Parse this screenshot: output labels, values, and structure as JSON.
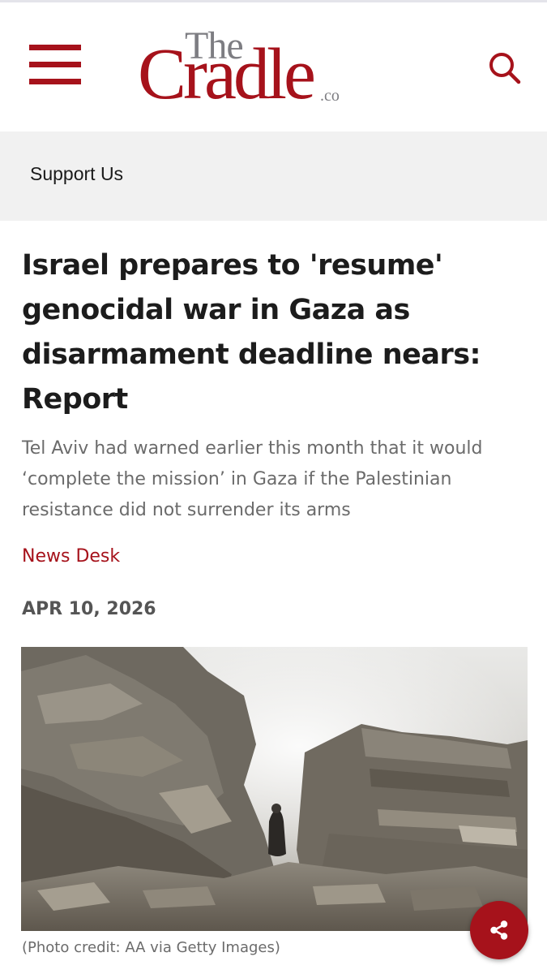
{
  "header": {
    "menu_icon": "hamburger-menu-icon",
    "logo": {
      "the": "The",
      "cradle": "Cradle",
      "co": ".co"
    },
    "search_icon": "search-icon",
    "brand_color": "#a6121b"
  },
  "support": {
    "label": "Support Us"
  },
  "article": {
    "headline": "Israel prepares to 'resume' genocidal war in Gaza as disarmament deadline nears: Report",
    "subtitle": "Tel Aviv had warned earlier this month that it would ‘complete the mission’ in Gaza if the Palestinian resistance did not surrender its arms",
    "author": "News Desk",
    "date": "APR 10, 2026",
    "photo_caption": "(Photo credit: AA via Getty Images)"
  },
  "share": {
    "icon": "share-icon"
  }
}
